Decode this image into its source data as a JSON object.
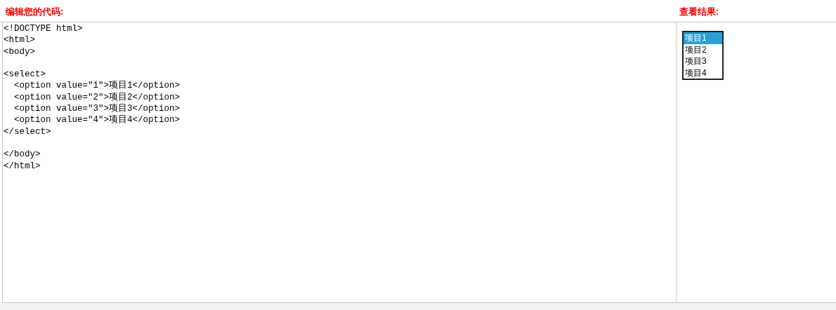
{
  "editor": {
    "title": "编辑您的代码:",
    "code": "<!DOCTYPE html>\n<html>\n<body>\n\n<select>\n  <option value=\"1\">项目1</option>\n  <option value=\"2\">项目2</option>\n  <option value=\"3\">项目3</option>\n  <option value=\"4\">项目4</option>\n</select>\n\n</body>\n</html>"
  },
  "result": {
    "title": "查看结果:",
    "options": [
      {
        "label": "项目1",
        "selected": true
      },
      {
        "label": "项目2",
        "selected": false
      },
      {
        "label": "项目3",
        "selected": false
      },
      {
        "label": "项目4",
        "selected": false
      }
    ]
  }
}
